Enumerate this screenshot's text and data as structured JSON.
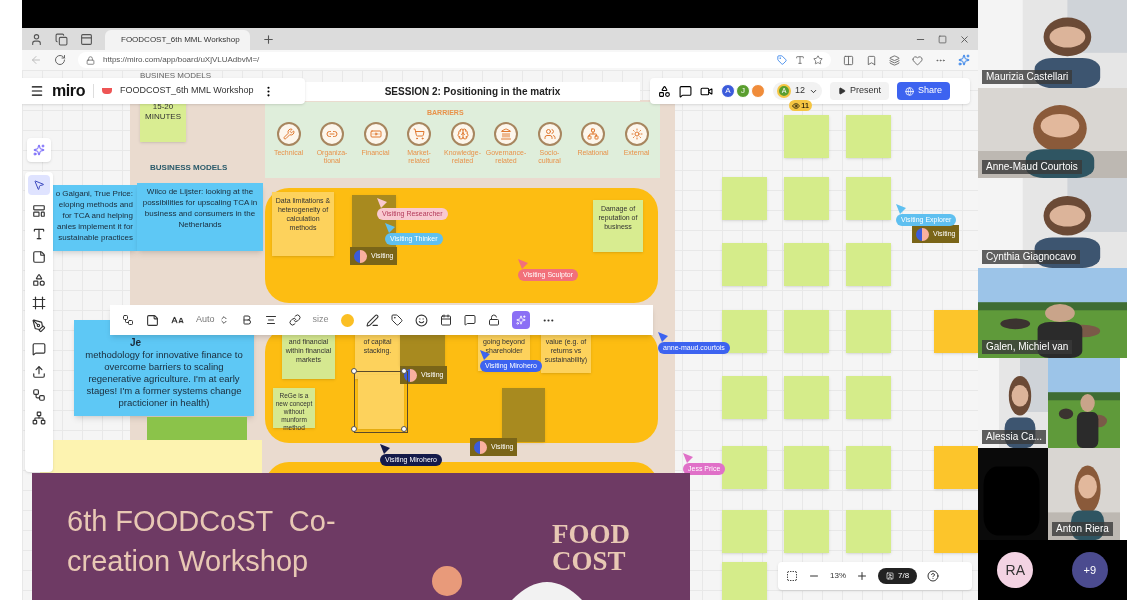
{
  "browser": {
    "tab_title": "FOODCOST_6th MML Workshop",
    "url": "https://miro.com/app/board/uXjVLUAdbvM=/"
  },
  "board_header": {
    "logo": "miro",
    "board_name": "FOODCOST_6th MML Workshop",
    "frame_label": "BUSINES MODELS",
    "session_title": "SESSION 2: Positioning in the matrix"
  },
  "collaboration": {
    "avatars": [
      {
        "initial": "A",
        "color": "#3b5bdb"
      },
      {
        "initial": "J",
        "color": "#5a9e2f"
      },
      {
        "color": "#f08c3a"
      }
    ],
    "me": "A",
    "count": "12",
    "viewers": "11",
    "present": "Present",
    "share": "Share"
  },
  "timer_note": "15-20 MINUTES",
  "business_models_label": "BUSINESS MODELS",
  "barriers": {
    "title": "BARRIERS",
    "items": [
      {
        "label": [
          "Technical"
        ]
      },
      {
        "label": [
          "Organiza-",
          "tional"
        ]
      },
      {
        "label": [
          "Financial"
        ]
      },
      {
        "label": [
          "Market-",
          "related"
        ]
      },
      {
        "label": [
          "Knowledge-",
          "related"
        ]
      },
      {
        "label": [
          "Governance-",
          "related"
        ]
      },
      {
        "label": [
          "Socio-",
          "cultural"
        ]
      },
      {
        "label": [
          "Relational"
        ]
      },
      {
        "label": [
          "External"
        ]
      }
    ]
  },
  "profile_notes": [
    {
      "lines": [
        "o Galgani, True Price:",
        "eloping methods and",
        "for TCA and helping",
        "anies implement it for",
        "sustainable practices"
      ]
    },
    {
      "lines": [
        "Wilco de Lijster: looking at the possibilities for upscaling TCA in business and consumers in the Netherlands"
      ]
    },
    {
      "heading": "Je",
      "lines": [
        "methodology for innovative finance to overcome barriers to scaling regenerative agriculture. I'm at early stages! I'm a former systems change practicioner in health)"
      ]
    }
  ],
  "stickies": [
    {
      "text": "Data limitations & heterogeneity of calculation methods",
      "color": "#fdd25c"
    },
    {
      "color": "#a88a1f"
    },
    {
      "text": "Damage of reputation of business",
      "color": "#d8ec90"
    },
    {
      "text": "and financial within financial markets",
      "color": "#d5e890"
    },
    {
      "text": "of capital stacking.",
      "color": "#fdd25c"
    },
    {
      "color": "#a88a1f"
    },
    {
      "text": "going beyond shareholder",
      "color": "#fdd25c"
    },
    {
      "text": "value (e.g. of returns vs sustainability)",
      "color": "#fdd25c"
    },
    {
      "text": "ReGe is a new concept without munform method",
      "color": "#d5e890"
    },
    {
      "color": "#fdd25c"
    },
    {
      "color": "#a88a1f"
    }
  ],
  "cursors": [
    {
      "label": "Visiting Researcher",
      "color": "#f9c9d0"
    },
    {
      "label": "Visiting Thinker",
      "color": "#5fc0f0"
    },
    {
      "label": "Visiting Sculptor",
      "color": "#f2707a"
    },
    {
      "label": "Visiting Mirohero",
      "color": "#3d63f0"
    },
    {
      "label": "Visiting Mirohero",
      "color": "#141a4a"
    },
    {
      "label": "anne-maud.courtois",
      "color": "#3d63f0"
    },
    {
      "label": "Jess Price",
      "color": "#e070c8"
    },
    {
      "label": "Visiting Explorer",
      "color": "#5fc0f0"
    }
  ],
  "visiting_badges": [
    "Visiting",
    "Visiting",
    "Visiting",
    "Visiting"
  ],
  "format_toolbar": {
    "font_size": "Auto",
    "size_label": "size",
    "color": "#fbbf24"
  },
  "zoom": {
    "level": "13%",
    "page": "7/8"
  },
  "banner": {
    "title": "6th FOODCoST  Co-creation Workshop",
    "logo_lines": [
      "FOOD",
      "COST"
    ]
  },
  "participants": [
    {
      "name": "Maurizia Castellari"
    },
    {
      "name": "Anne-Maud Courtois"
    },
    {
      "name": "Cynthia Giagnocavo"
    },
    {
      "name": "Galen, Michiel van"
    },
    {
      "name": "Alessia Ca..."
    },
    {
      "name": "Anton Riera"
    }
  ],
  "overflow": [
    {
      "label": "RA",
      "color": "#f3d3e3"
    },
    {
      "label": "+9",
      "color": "#4b4b8f"
    }
  ]
}
